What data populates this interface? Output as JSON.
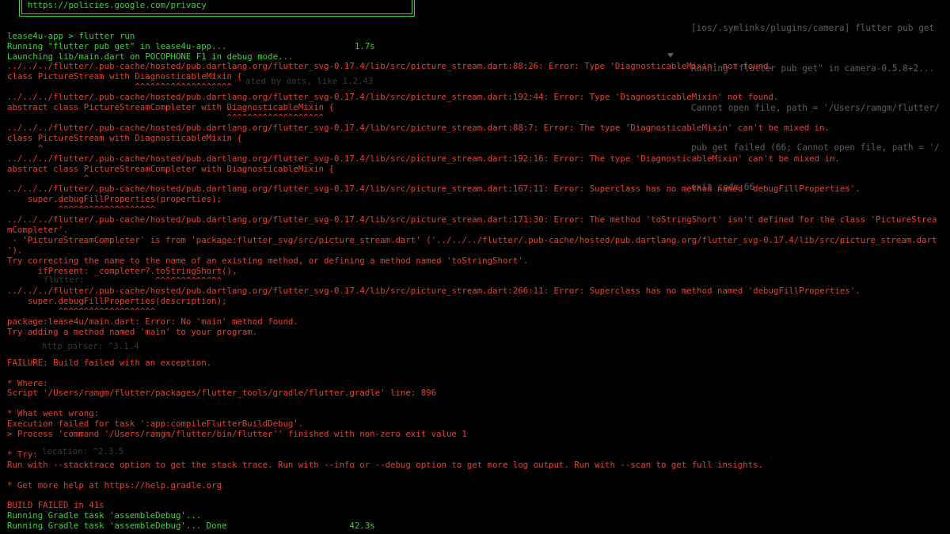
{
  "colors": {
    "terminal_background": "#000000",
    "standard_output": "#3cd13c",
    "error_output": "#e4402e",
    "privacy_box_border": "#3cd13c",
    "background_window_text": "#5f5f5f",
    "background_window_faint_text": "#3a3a3a"
  },
  "privacy_box": {
    "url": "https://policies.google.com/privacy"
  },
  "terminal": {
    "lines": [
      "lease4u-app > flutter run",
      "Running \"flutter pub get\" in lease4u-app...",
      "Launching lib/main.dart on POCOPHONE F1 in debug mode...",
      "../../../flutter/.pub-cache/hosted/pub.dartlang.org/flutter_svg-0.17.4/lib/src/picture_stream.dart:88:26: Error: Type 'DiagnosticableMixin' not found.",
      "class PictureStream with DiagnosticableMixin {",
      "                         ^^^^^^^^^^^^^^^^^^^",
      "../../../flutter/.pub-cache/hosted/pub.dartlang.org/flutter_svg-0.17.4/lib/src/picture_stream.dart:192:44: Error: Type 'DiagnosticableMixin' not found.",
      "abstract class PictureStreamCompleter with DiagnosticableMixin {",
      "                                           ^^^^^^^^^^^^^^^^^^^",
      "../../../flutter/.pub-cache/hosted/pub.dartlang.org/flutter_svg-0.17.4/lib/src/picture_stream.dart:88:7: Error: The type 'DiagnosticableMixin' can't be mixed in.",
      "class PictureStream with DiagnosticableMixin {",
      "      ^",
      "../../../flutter/.pub-cache/hosted/pub.dartlang.org/flutter_svg-0.17.4/lib/src/picture_stream.dart:192:16: Error: The type 'DiagnosticableMixin' can't be mixed in.",
      "abstract class PictureStreamCompleter with DiagnosticableMixin {",
      "               ^",
      "../../../flutter/.pub-cache/hosted/pub.dartlang.org/flutter_svg-0.17.4/lib/src/picture_stream.dart:167:11: Error: Superclass has no method named 'debugFillProperties'.",
      "    super.debugFillProperties(properties);",
      "          ^^^^^^^^^^^^^^^^^^^",
      "../../../flutter/.pub-cache/hosted/pub.dartlang.org/flutter_svg-0.17.4/lib/src/picture_stream.dart:171:30: Error: The method 'toStringShort' isn't defined for the class 'PictureStrea",
      "mCompleter'.",
      " - 'PictureStreamCompleter' is from 'package:flutter_svg/src/picture_stream.dart' ('../../../flutter/.pub-cache/hosted/pub.dartlang.org/flutter_svg-0.17.4/lib/src/picture_stream.dart",
      "').",
      "Try correcting the name to the name of an existing method, or defining a method named 'toStringShort'.",
      "      ifPresent: _completer?.toStringShort(),",
      "                             ^^^^^^^^^^^^^",
      "../../../flutter/.pub-cache/hosted/pub.dartlang.org/flutter_svg-0.17.4/lib/src/picture_stream.dart:266:11: Error: Superclass has no method named 'debugFillProperties'.",
      "    super.debugFillProperties(description);",
      "          ^^^^^^^^^^^^^^^^^^^",
      "package:lease4u/main.dart: Error: No 'main' method found.",
      "Try adding a method named 'main' to your program.",
      "FAILURE: Build failed with an exception.",
      "* Where:",
      "Script '/Users/ramgm/flutter/packages/flutter_tools/gradle/flutter.gradle' line: 896",
      "* What went wrong:",
      "Execution failed for task ':app:compileFlutterBuildDebug'.",
      "> Process 'command '/Users/ramgm/flutter/bin/flutter'' finished with non-zero exit value 1",
      "* Try:",
      "Run with --stacktrace option to get the stack trace. Run with --info or --debug option to get more log output. Run with --scan to get full insights.",
      "* Get more help at ",
      "BUILD FAILED in 41s",
      "Running Gradle task 'assembleDebug'...",
      "Running Gradle task 'assembleDebug'... Done"
    ],
    "pub_get_duration": "1.7s",
    "assemble_duration": "42.3s",
    "help_link": "https://help.gradle.org"
  },
  "background_window": {
    "output_panel": [
      "[ios/.symlinks/plugins/camera] flutter pub get",
      "Running \"flutter pub get\" in camera-0.5.8+2...",
      "Cannot open file, path = '/Users/ramgm/flutter/",
      "pub get failed (66; Cannot open file, path = '/",
      "exit code 66"
    ],
    "editor_fragments": [
      "ated by dots, like 1.2.43",
      "flutter:",
      "http_parser: ^3.1.4",
      "location: ^2.3.5"
    ],
    "collapse_icon": "triangle-down-icon"
  }
}
